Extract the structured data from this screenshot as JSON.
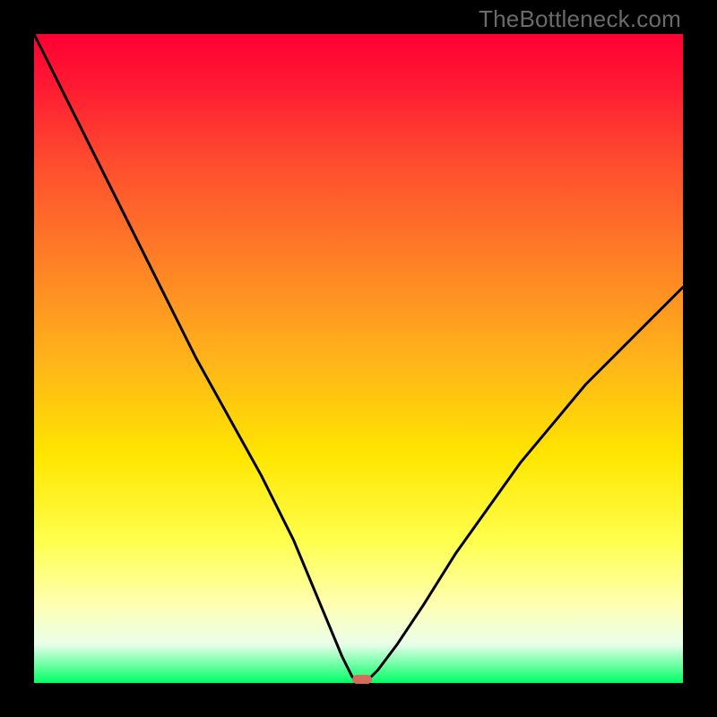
{
  "brand": {
    "watermark": "TheBottleneck.com"
  },
  "chart_data": {
    "type": "line",
    "title": "",
    "xlabel": "",
    "ylabel": "",
    "xlim": [
      0,
      1
    ],
    "ylim": [
      0,
      1
    ],
    "x": [
      0.0,
      0.05,
      0.1,
      0.15,
      0.2,
      0.25,
      0.3,
      0.35,
      0.4,
      0.45,
      0.475,
      0.49,
      0.5,
      0.51,
      0.53,
      0.56,
      0.6,
      0.65,
      0.7,
      0.75,
      0.8,
      0.85,
      0.9,
      0.95,
      1.0
    ],
    "values": [
      1.0,
      0.9,
      0.8,
      0.7,
      0.6,
      0.5,
      0.41,
      0.32,
      0.22,
      0.1,
      0.04,
      0.01,
      0.0,
      0.0,
      0.02,
      0.06,
      0.12,
      0.2,
      0.27,
      0.34,
      0.4,
      0.46,
      0.51,
      0.56,
      0.61
    ],
    "background_gradient": {
      "stops": [
        {
          "pos": 0.0,
          "color": "#ff0033"
        },
        {
          "pos": 0.35,
          "color": "#ff8026"
        },
        {
          "pos": 0.65,
          "color": "#ffe600"
        },
        {
          "pos": 0.94,
          "color": "#eaffea"
        },
        {
          "pos": 1.0,
          "color": "#00ff66"
        }
      ]
    },
    "marker": {
      "x": 0.505,
      "y": 0.0,
      "color": "#d86a5d"
    }
  }
}
